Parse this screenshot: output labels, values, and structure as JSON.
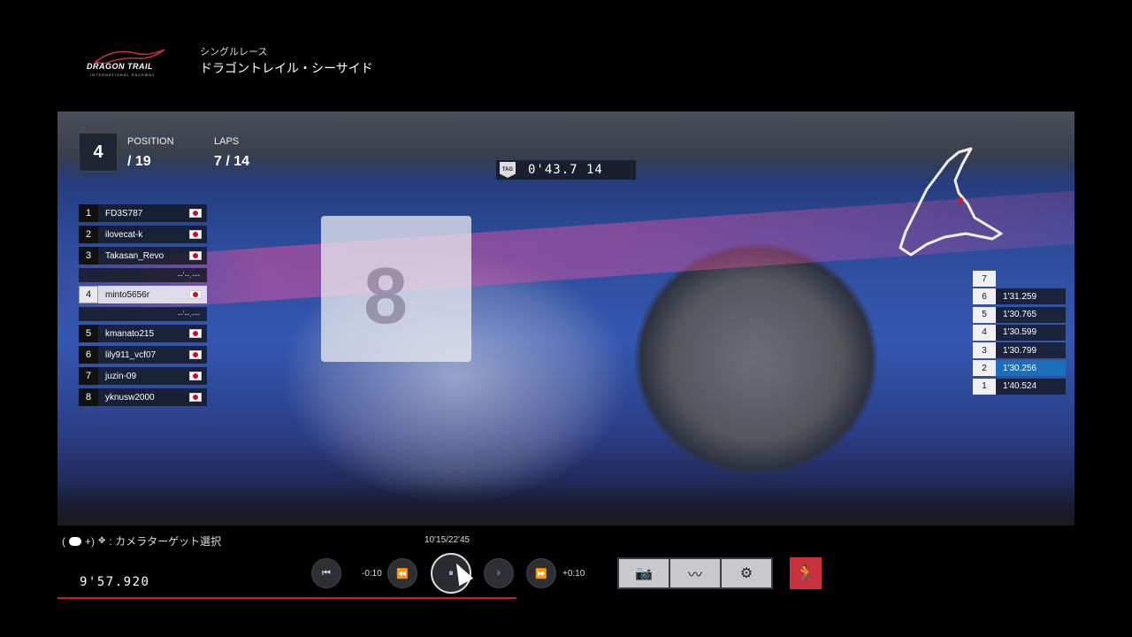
{
  "header": {
    "logo_text": "DRAGON TRAIL",
    "logo_sub": "INTERNATIONAL RACEWAY",
    "race_type": "シングルレース",
    "track_name": "ドラゴントレイル・シーサイド"
  },
  "hud": {
    "position": "4",
    "position_label": "POSITION",
    "position_total": "/ 19",
    "laps_label": "LAPS",
    "laps_value": "7 / 14",
    "timer": "0'43.7 14",
    "tag_icon_text": "TAG"
  },
  "standings": {
    "rows": [
      {
        "pos": "1",
        "name": "FD3S787"
      },
      {
        "pos": "2",
        "name": "ilovecat-k"
      },
      {
        "pos": "3",
        "name": "Takasan_Revo"
      }
    ],
    "gap_above": "--'--.---",
    "me": {
      "pos": "4",
      "name": "minto5656r"
    },
    "gap_below": "--'--.---",
    "rows_after": [
      {
        "pos": "5",
        "name": "kmanato215"
      },
      {
        "pos": "6",
        "name": "lily911_vcf07"
      },
      {
        "pos": "7",
        "name": "juzin-09"
      },
      {
        "pos": "8",
        "name": "yknusw2000"
      }
    ]
  },
  "laptimes": [
    {
      "lap": "7",
      "time": ""
    },
    {
      "lap": "6",
      "time": "1'31.259"
    },
    {
      "lap": "5",
      "time": "1'30.765"
    },
    {
      "lap": "4",
      "time": "1'30.599"
    },
    {
      "lap": "3",
      "time": "1'30.799"
    },
    {
      "lap": "2",
      "time": "1'30.256"
    },
    {
      "lap": "1",
      "time": "1'40.524"
    }
  ],
  "controls": {
    "camera_hint_prefix": "(",
    "camera_hint_plus": "+)",
    "camera_hint": ": カメラターゲット選択",
    "replay_time": "10'15/22'45",
    "elapsed": "9'57.920",
    "rewind_label": "-0:10",
    "forward_label": "+0:10",
    "prev_icon": "⏮",
    "rewind_icon": "⏪",
    "pause_icon": "⏸",
    "step_icon": "⏵",
    "forward_icon": "⏩",
    "camera_icon": "📷",
    "chart_icon": "〰",
    "gear_icon": "⚙",
    "exit_icon": "🏃"
  }
}
